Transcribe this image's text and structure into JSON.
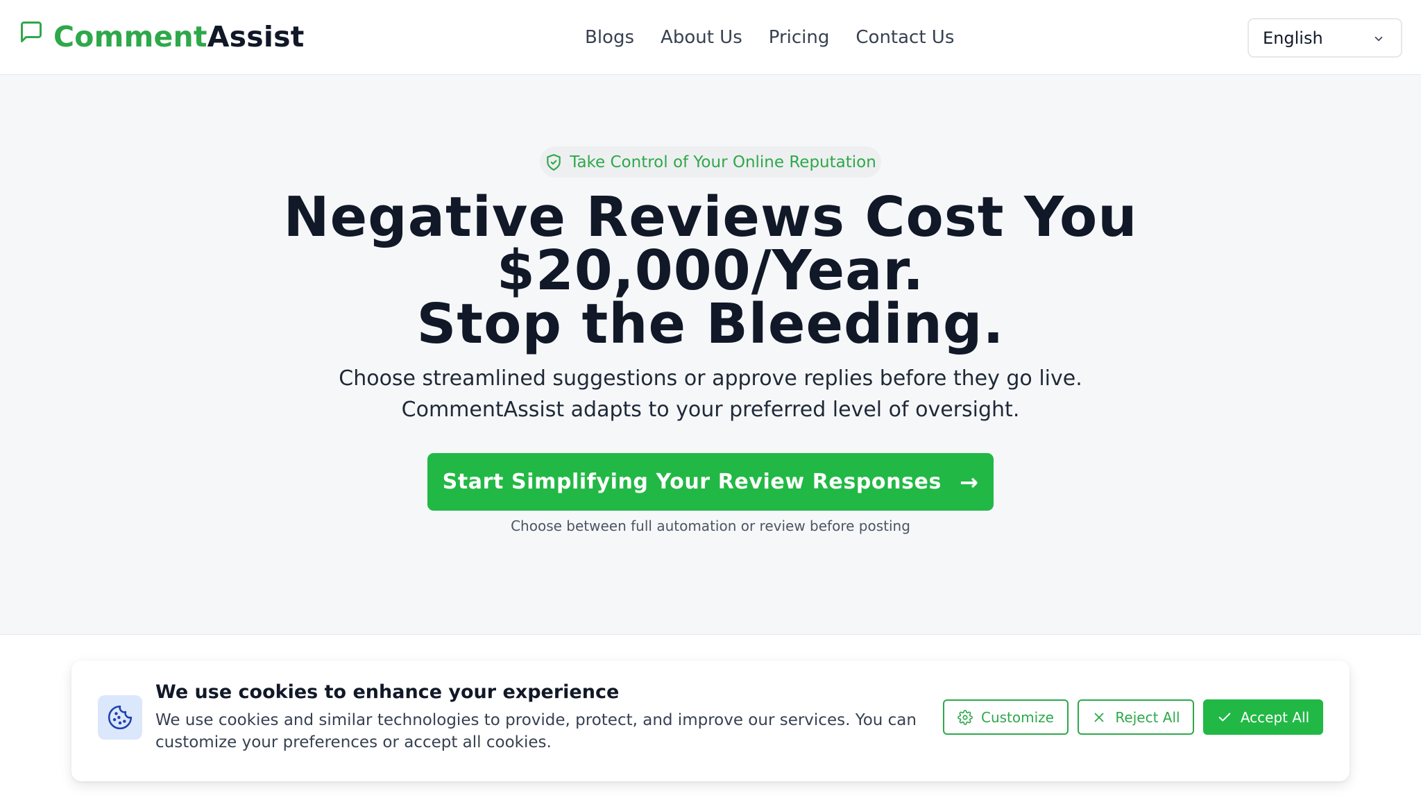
{
  "header": {
    "brand_first": "Comment",
    "brand_second": "Assist",
    "nav": [
      "Blogs",
      "About Us",
      "Pricing",
      "Contact Us"
    ],
    "language": "English",
    "icons": {
      "logo": "message-square-icon",
      "language": "chevron-down-icon"
    }
  },
  "hero": {
    "badge": "Take Control of Your Online Reputation",
    "badge_icon": "shield-check-icon",
    "headline": [
      "Negative Reviews Cost You",
      "$20,000/Year.",
      "Stop the Bleeding."
    ],
    "subtext": [
      "Choose streamlined suggestions or approve replies before they go live.",
      "CommentAssist adapts to your preferred level of oversight."
    ],
    "cta_label": "Start Simplifying Your Review Responses",
    "cta_arrow": "→",
    "cta_note": "Choose between full automation or review before posting"
  },
  "cookie_banner": {
    "icon": "cookie-icon",
    "title": "We use cookies to enhance your experience",
    "text": "We use cookies and similar technologies to provide, protect, and improve our services. You can customize your preferences or accept all cookies.",
    "buttons": {
      "customize": "Customize",
      "reject": "Reject All",
      "accept": "Accept All"
    },
    "button_icons": {
      "customize": "gear-icon",
      "reject": "x-icon",
      "accept": "check-icon"
    }
  },
  "colors": {
    "brand_green": "#2ea84a",
    "cta_green": "#22b845",
    "text_dark": "#111827",
    "background": "#f6f7f9",
    "cookie_icon_bg": "#dbe7fb"
  }
}
